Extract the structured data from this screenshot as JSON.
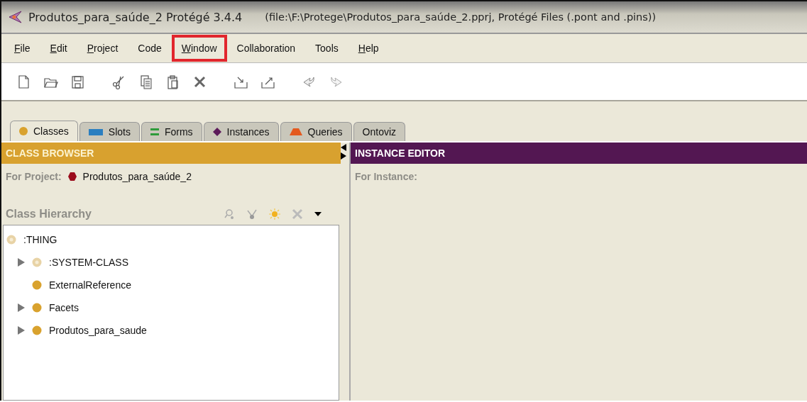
{
  "window": {
    "title": "Produtos_para_saúde_2  Protégé 3.4.4",
    "file": "(file:\\F:\\Protege\\Produtos_para_saúde_2.pprj, Protégé Files (.pont and .pins))"
  },
  "menu": [
    {
      "label": "File",
      "underline": true,
      "highlighted": false
    },
    {
      "label": "Edit",
      "underline": true,
      "highlighted": false
    },
    {
      "label": "Project",
      "underline": true,
      "highlighted": false
    },
    {
      "label": "Code",
      "underline": false,
      "highlighted": false
    },
    {
      "label": "Window",
      "underline": true,
      "highlighted": true
    },
    {
      "label": "Collaboration",
      "underline": false,
      "highlighted": false
    },
    {
      "label": "Tools",
      "underline": false,
      "highlighted": false
    },
    {
      "label": "Help",
      "underline": true,
      "highlighted": false
    }
  ],
  "tabs": [
    {
      "label": "Classes",
      "kind": "circle",
      "selected": true
    },
    {
      "label": "Slots",
      "kind": "bar",
      "selected": false
    },
    {
      "label": "Forms",
      "kind": "lines",
      "selected": false
    },
    {
      "label": "Instances",
      "kind": "diamond",
      "selected": false
    },
    {
      "label": "Queries",
      "kind": "trapezoid",
      "selected": false
    },
    {
      "label": "Ontoviz",
      "kind": "none",
      "selected": false
    }
  ],
  "class_browser": {
    "header": "CLASS BROWSER",
    "project_label": "For Project:",
    "project": "Produtos_para_saúde_2",
    "hierarchy_label": "Class Hierarchy",
    "tree": [
      {
        "label": ":THING",
        "kind": "system",
        "collapsed": false,
        "children": [
          {
            "label": ":SYSTEM-CLASS",
            "kind": "system",
            "collapsed": true
          },
          {
            "label": "ExternalReference",
            "kind": "class",
            "collapsed": false
          },
          {
            "label": "Facets",
            "kind": "class",
            "collapsed": true
          },
          {
            "label": "Produtos_para_saude",
            "kind": "class",
            "collapsed": true
          }
        ]
      }
    ]
  },
  "instance_editor": {
    "header": "INSTANCE EDITOR",
    "instance_label": "For Instance:"
  }
}
